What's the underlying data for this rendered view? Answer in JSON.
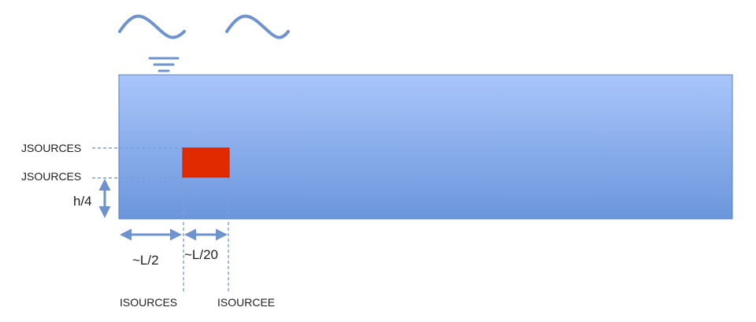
{
  "labels": {
    "jsource_top": "JSOURCES",
    "jsource_bottom": "JSOURCES",
    "depth_fraction": "h/4",
    "half_length": "~L/2",
    "source_width": "~L/20",
    "isource_start": "ISOURCES",
    "isource_end": "ISOURCEE"
  },
  "colors": {
    "domain_top": "#a9c5fb",
    "domain_bottom": "#6b96dc",
    "domain_edge": "#5a82c6",
    "source_fill": "#e22a00",
    "arrow": "#6f93cf",
    "dash": "#7f9fd6",
    "wave": "#6f93cf"
  },
  "icons": {
    "wave_left": "sine-wave-icon",
    "wave_right": "sine-wave-icon",
    "water_surface": "water-level-icon"
  }
}
